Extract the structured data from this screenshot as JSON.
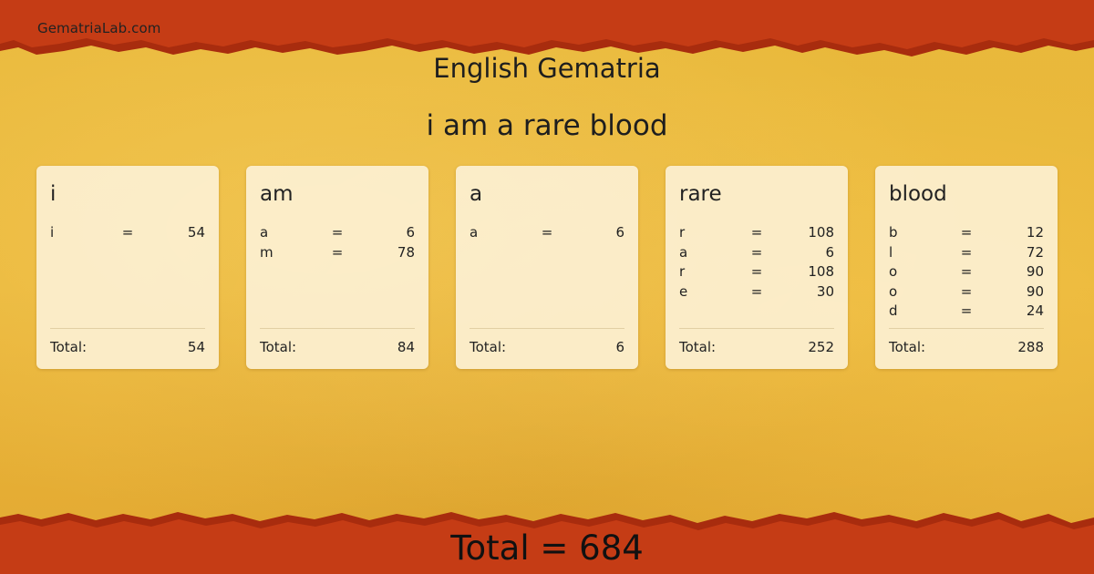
{
  "site": "GematriaLab.com",
  "title": "English Gematria",
  "phrase": "i am a rare blood",
  "colors": {
    "edge": "#c23a14",
    "edge_dark": "#a82c0e",
    "paper": "#e9b93b",
    "card": "#fdf3da"
  },
  "words": [
    {
      "word": "i",
      "letters": [
        {
          "ch": "i",
          "eq": "=",
          "val": "54"
        }
      ],
      "total_label": "Total:",
      "total": "54"
    },
    {
      "word": "am",
      "letters": [
        {
          "ch": "a",
          "eq": "=",
          "val": "6"
        },
        {
          "ch": "m",
          "eq": "=",
          "val": "78"
        }
      ],
      "total_label": "Total:",
      "total": "84"
    },
    {
      "word": "a",
      "letters": [
        {
          "ch": "a",
          "eq": "=",
          "val": "6"
        }
      ],
      "total_label": "Total:",
      "total": "6"
    },
    {
      "word": "rare",
      "letters": [
        {
          "ch": "r",
          "eq": "=",
          "val": "108"
        },
        {
          "ch": "a",
          "eq": "=",
          "val": "6"
        },
        {
          "ch": "r",
          "eq": "=",
          "val": "108"
        },
        {
          "ch": "e",
          "eq": "=",
          "val": "30"
        }
      ],
      "total_label": "Total:",
      "total": "252"
    },
    {
      "word": "blood",
      "letters": [
        {
          "ch": "b",
          "eq": "=",
          "val": "12"
        },
        {
          "ch": "l",
          "eq": "=",
          "val": "72"
        },
        {
          "ch": "o",
          "eq": "=",
          "val": "90"
        },
        {
          "ch": "o",
          "eq": "=",
          "val": "90"
        },
        {
          "ch": "d",
          "eq": "=",
          "val": "24"
        }
      ],
      "total_label": "Total:",
      "total": "288"
    }
  ],
  "grand_total": "Total = 684"
}
